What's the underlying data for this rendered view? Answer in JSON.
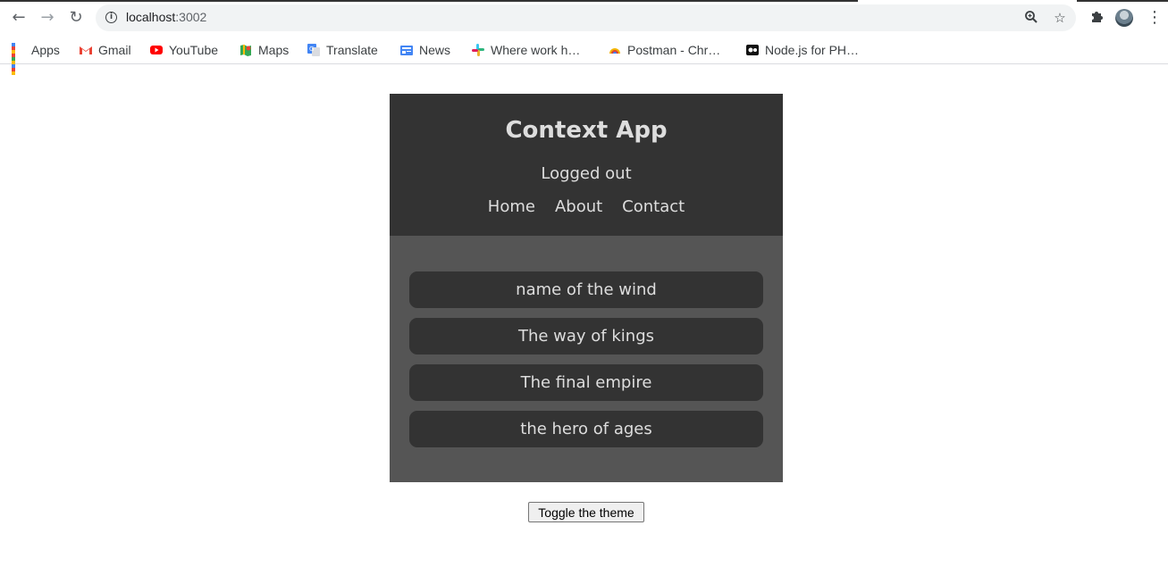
{
  "browser": {
    "url_host": "localhost",
    "url_port": ":3002",
    "bookmarks": [
      {
        "label": "Apps",
        "icon": "apps-grid-icon"
      },
      {
        "label": "Gmail",
        "icon": "gmail-icon"
      },
      {
        "label": "YouTube",
        "icon": "youtube-icon"
      },
      {
        "label": "Maps",
        "icon": "maps-icon"
      },
      {
        "label": "Translate",
        "icon": "translate-icon"
      },
      {
        "label": "News",
        "icon": "news-icon"
      },
      {
        "label": "Where work h…",
        "icon": "slack-icon"
      },
      {
        "label": "Postman - Chr…",
        "icon": "postman-icon"
      },
      {
        "label": "Node.js for PH…",
        "icon": "nodejs-icon"
      }
    ]
  },
  "app": {
    "title": "Context App",
    "auth_status": "Logged out",
    "nav": [
      "Home",
      "About",
      "Contact"
    ],
    "books": [
      "name of the wind",
      "The way of kings",
      "The final empire",
      "the hero of ages"
    ],
    "toggle_label": "Toggle the theme",
    "colors": {
      "header_bg": "#333333",
      "body_bg": "#555555",
      "text": "#dddddd"
    }
  }
}
